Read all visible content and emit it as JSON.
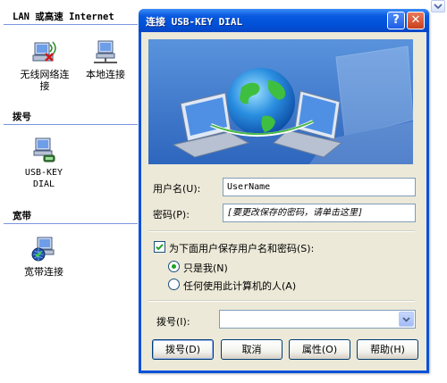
{
  "left_pane": {
    "groups": {
      "lan": "LAN 或高速 Internet",
      "dialup": "拨号",
      "broadband": "宽带"
    },
    "connections": {
      "wireless": "无线网络连接",
      "local": "本地连接",
      "usbkey_line1": "USB-KEY",
      "usbkey_line2": "DIAL",
      "broadband": "宽带连接"
    }
  },
  "dialog": {
    "title": "连接 USB-KEY DIAL",
    "help_button": "?",
    "close_button": "✕",
    "username_label": "用户名(U):",
    "username_value": "UserName",
    "password_label": "密码(P):",
    "password_value": "[要更改保存的密码，请单击这里]",
    "save_checkbox_label": "为下面用户保存用户名和密码(S):",
    "save_checked": true,
    "option_me_only": "只是我(N)",
    "option_anyone": "任何使用此计算机的人(A)",
    "selected_option": "me_only",
    "dial_label": "拨号(I):",
    "dial_value": "",
    "buttons": {
      "dial": "拨号(D)",
      "cancel": "取消",
      "properties": "属性(O)",
      "help": "帮助(H)"
    }
  },
  "colors": {
    "title_blue": "#0a52d8",
    "dialog_bg": "#ece9d8",
    "banner_blue": "#3a77c9",
    "radio_green": "#21a121"
  },
  "icons": {
    "wireless": "wireless-connection-icon",
    "local": "local-connection-icon",
    "usbkey": "dialup-connection-icon",
    "broadband": "broadband-connection-icon",
    "banner": "network-globe-laptops-illustration"
  }
}
